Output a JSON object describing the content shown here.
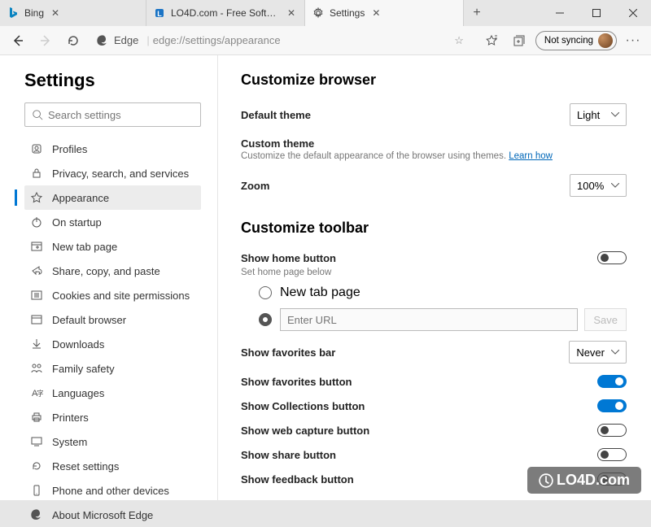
{
  "window": {
    "bing_tab": "Bing",
    "lo4d_tab": "LO4D.com - Free Software Dow",
    "settings_tab": "Settings"
  },
  "addr": {
    "brand": "Edge",
    "url": "edge://settings/appearance",
    "sync": "Not syncing"
  },
  "sidebar": {
    "title": "Settings",
    "search_ph": "Search settings",
    "items": {
      "profiles": "Profiles",
      "privacy": "Privacy, search, and services",
      "appearance": "Appearance",
      "startup": "On startup",
      "newtab": "New tab page",
      "share": "Share, copy, and paste",
      "cookies": "Cookies and site permissions",
      "defbrowser": "Default browser",
      "downloads": "Downloads",
      "family": "Family safety",
      "languages": "Languages",
      "printers": "Printers",
      "system": "System",
      "reset": "Reset settings",
      "phone": "Phone and other devices",
      "about": "About Microsoft Edge"
    }
  },
  "main": {
    "sec1": "Customize browser",
    "theme_label": "Default theme",
    "theme_value": "Light",
    "custom_theme": "Custom theme",
    "custom_theme_sub": "Customize the default appearance of the browser using themes.",
    "learn_how": "Learn how",
    "zoom_label": "Zoom",
    "zoom_value": "100%",
    "sec2": "Customize toolbar",
    "home_btn": "Show home button",
    "home_sub": "Set home page below",
    "radio_newtab": "New tab page",
    "url_ph": "Enter URL",
    "save": "Save",
    "favbar": "Show favorites bar",
    "favbar_value": "Never",
    "favbtn": "Show favorites button",
    "collections": "Show Collections button",
    "webcapture": "Show web capture button",
    "sharebtn": "Show share button",
    "feedback": "Show feedback button"
  },
  "watermark": "LO4D.com"
}
